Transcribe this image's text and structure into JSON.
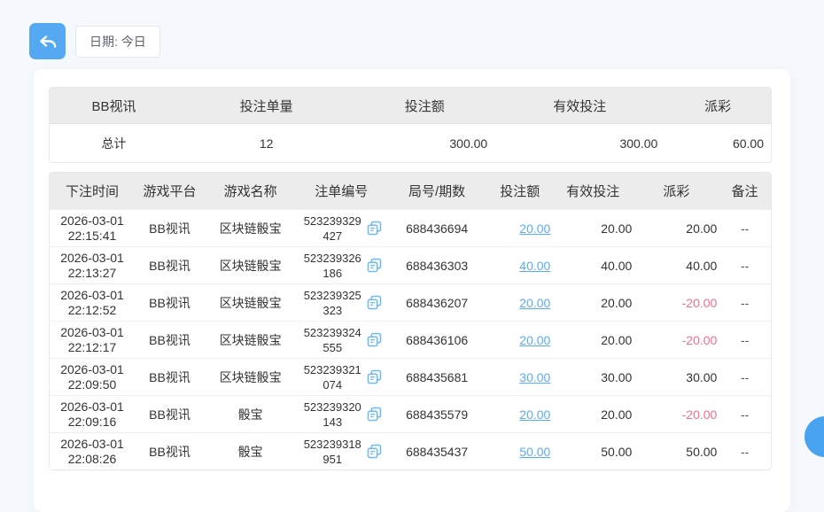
{
  "toolbar": {
    "date_label": "日期: 今日"
  },
  "summary": {
    "columns": [
      "BB视讯",
      "投注单量",
      "投注额",
      "有效投注",
      "派彩"
    ],
    "total": {
      "label": "总计",
      "count": "12",
      "bet_amount": "300.00",
      "valid_bet": "300.00",
      "payout": "60.00"
    }
  },
  "detail": {
    "columns": [
      "下注时间",
      "游戏平台",
      "游戏名称",
      "注单编号",
      "局号/期数",
      "投注额",
      "有效投注",
      "派彩",
      "备注"
    ],
    "rows": [
      {
        "date": "2026-03-01",
        "time": "22:15:41",
        "platform": "BB视讯",
        "game": "区块链骰宝",
        "order_top": "523239329",
        "order_bottom": "427",
        "round": "688436694",
        "bet": "20.00",
        "valid": "20.00",
        "payout": "20.00",
        "remark": "--"
      },
      {
        "date": "2026-03-01",
        "time": "22:13:27",
        "platform": "BB视讯",
        "game": "区块链骰宝",
        "order_top": "523239326",
        "order_bottom": "186",
        "round": "688436303",
        "bet": "40.00",
        "valid": "40.00",
        "payout": "40.00",
        "remark": "--"
      },
      {
        "date": "2026-03-01",
        "time": "22:12:52",
        "platform": "BB视讯",
        "game": "区块链骰宝",
        "order_top": "523239325",
        "order_bottom": "323",
        "round": "688436207",
        "bet": "20.00",
        "valid": "20.00",
        "payout": "-20.00",
        "remark": "--"
      },
      {
        "date": "2026-03-01",
        "time": "22:12:17",
        "platform": "BB视讯",
        "game": "区块链骰宝",
        "order_top": "523239324",
        "order_bottom": "555",
        "round": "688436106",
        "bet": "20.00",
        "valid": "20.00",
        "payout": "-20.00",
        "remark": "--"
      },
      {
        "date": "2026-03-01",
        "time": "22:09:50",
        "platform": "BB视讯",
        "game": "区块链骰宝",
        "order_top": "523239321",
        "order_bottom": "074",
        "round": "688435681",
        "bet": "30.00",
        "valid": "30.00",
        "payout": "30.00",
        "remark": "--"
      },
      {
        "date": "2026-03-01",
        "time": "22:09:16",
        "platform": "BB视讯",
        "game": "骰宝",
        "order_top": "523239320",
        "order_bottom": "143",
        "round": "688435579",
        "bet": "20.00",
        "valid": "20.00",
        "payout": "-20.00",
        "remark": "--"
      },
      {
        "date": "2026-03-01",
        "time": "22:08:26",
        "platform": "BB视讯",
        "game": "骰宝",
        "order_top": "523239318",
        "order_bottom": "951",
        "round": "688435437",
        "bet": "50.00",
        "valid": "50.00",
        "payout": "50.00",
        "remark": "--"
      }
    ]
  },
  "colors": {
    "accent_blue": "#55a8f2",
    "link_blue": "#58acf6",
    "negative_pink": "#f56c8c",
    "header_gray": "#ececec",
    "page_background": "#f5f8fc"
  }
}
